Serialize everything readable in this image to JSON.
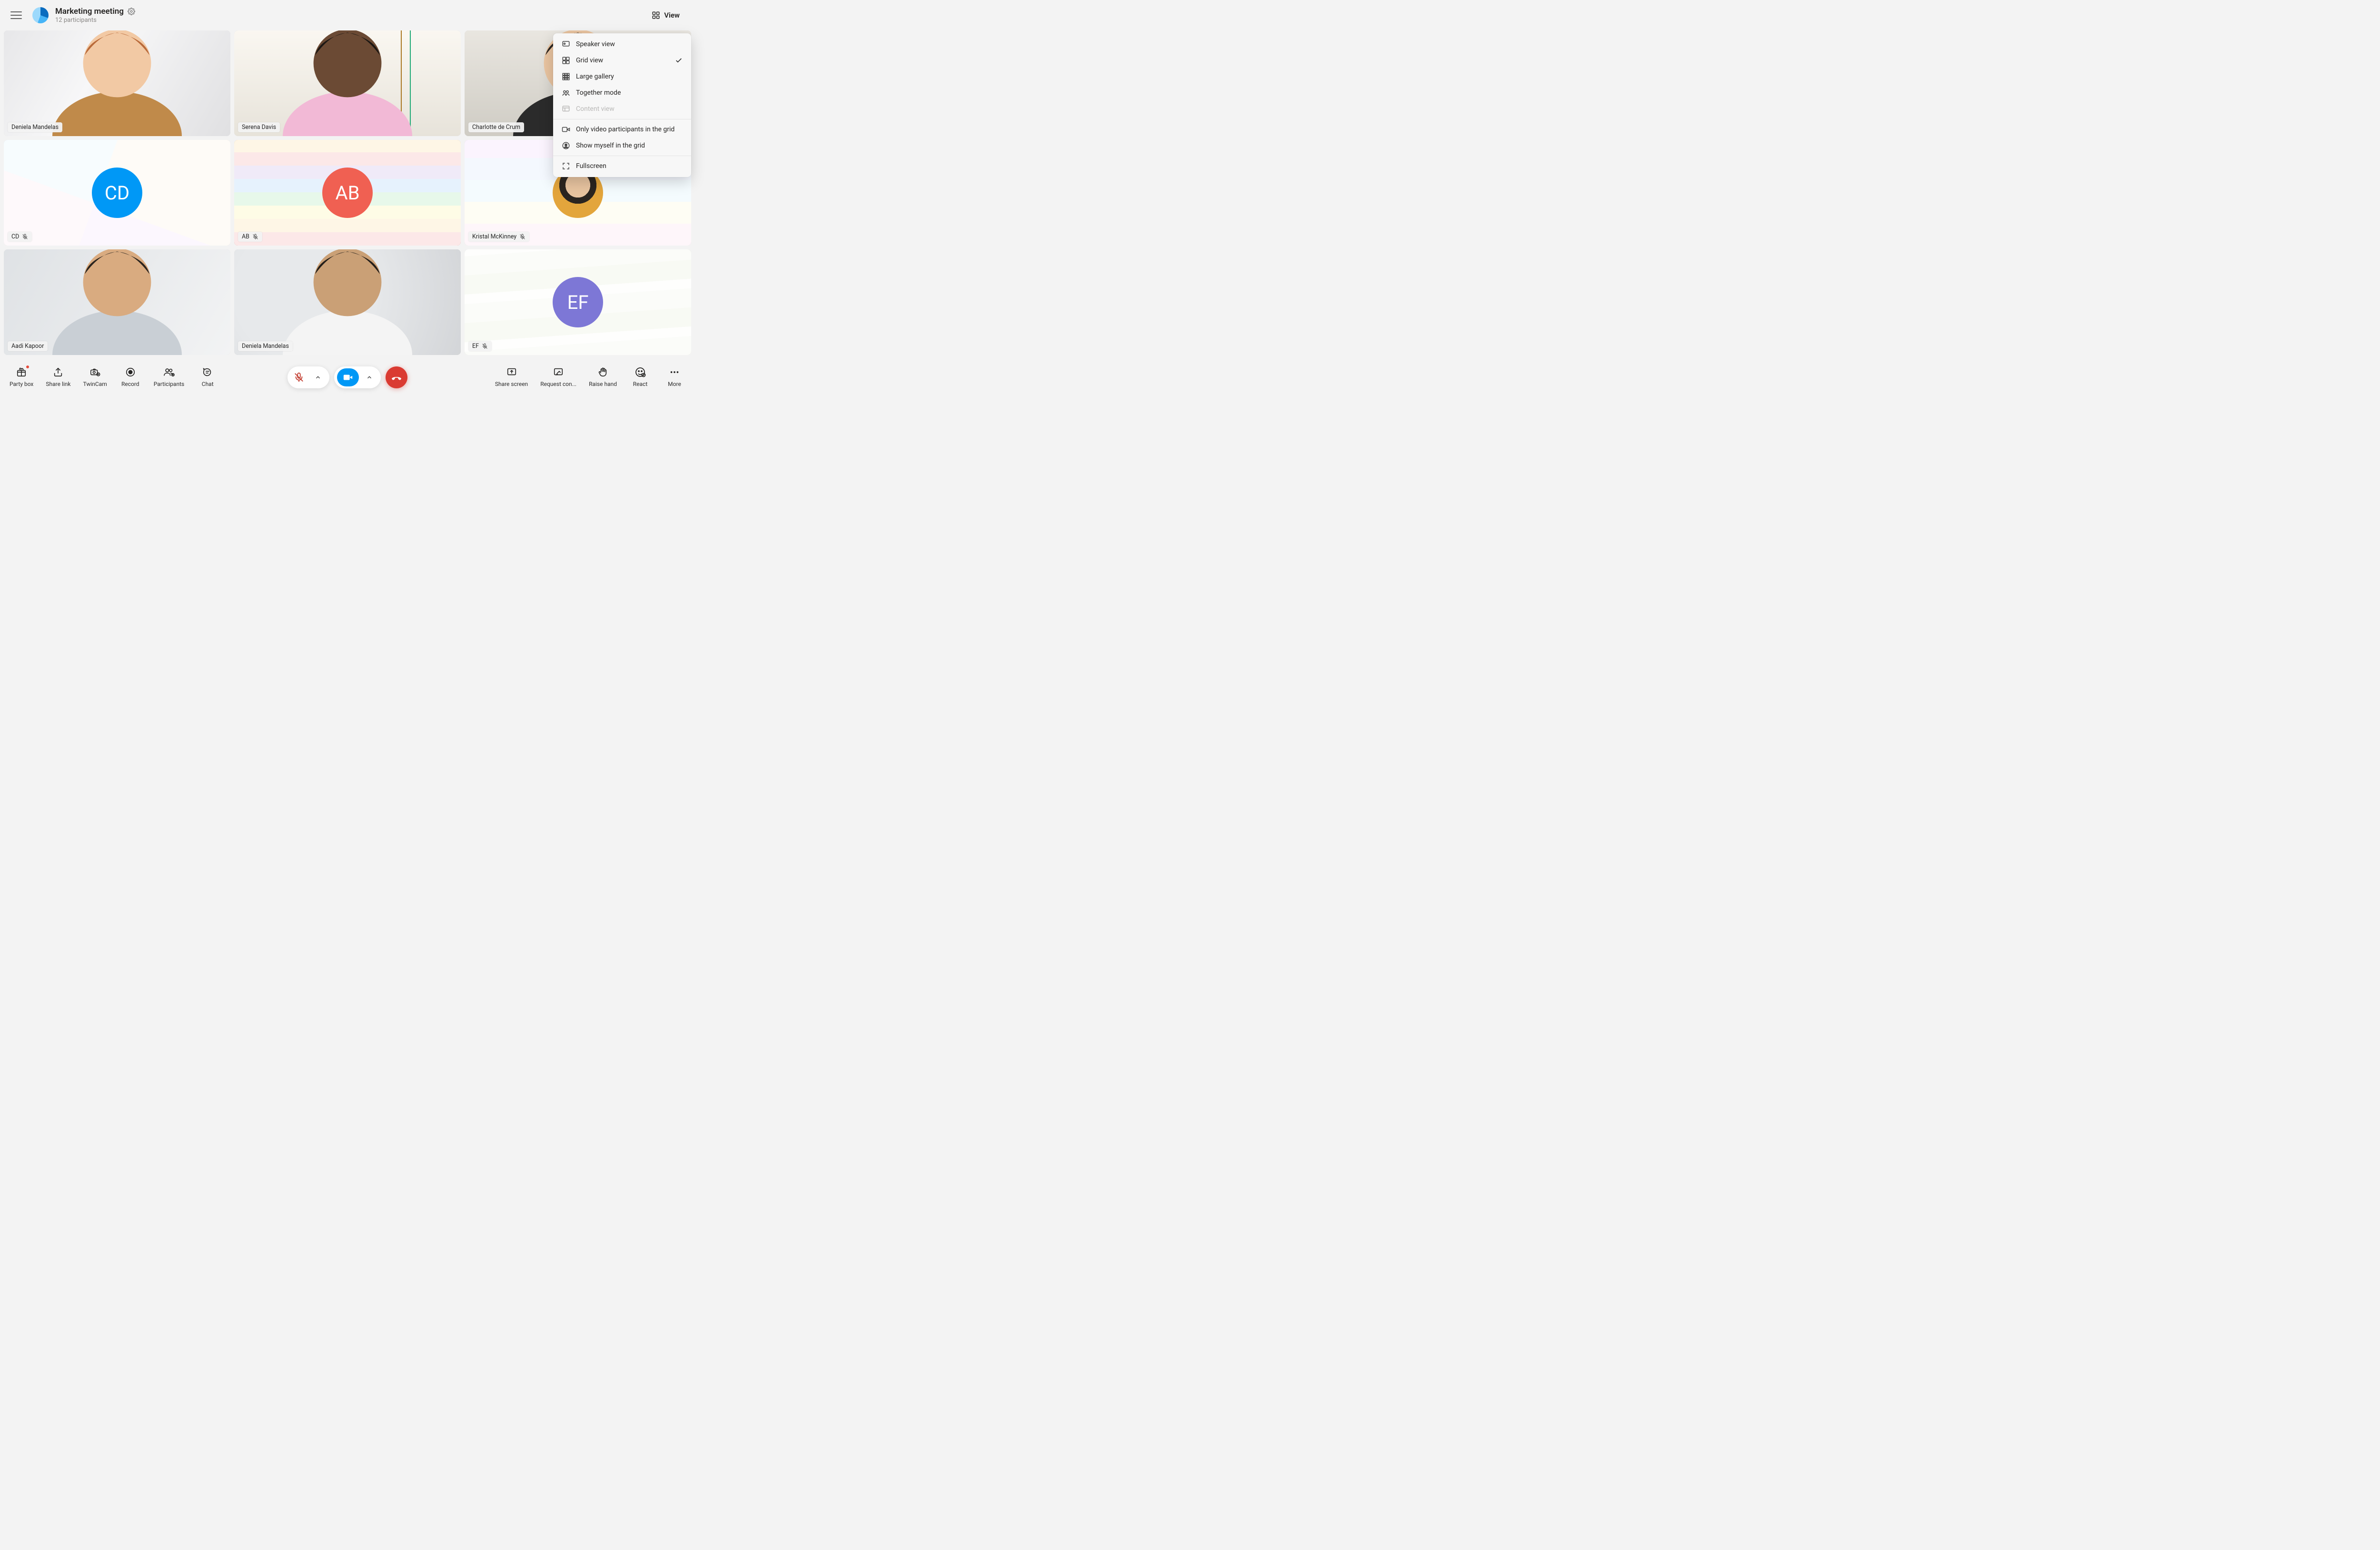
{
  "header": {
    "title": "Marketing meeting",
    "subtitle": "12 participants",
    "viewButton": "View"
  },
  "viewMenu": {
    "items": [
      {
        "icon": "speaker",
        "label": "Speaker view",
        "selected": false
      },
      {
        "icon": "grid",
        "label": "Grid view",
        "selected": true
      },
      {
        "icon": "large",
        "label": "Large gallery",
        "selected": false
      },
      {
        "icon": "together",
        "label": "Together mode",
        "selected": false
      },
      {
        "icon": "content",
        "label": "Content view",
        "disabled": true
      }
    ],
    "options": [
      {
        "icon": "video-only",
        "label": "Only video participants in the grid"
      },
      {
        "icon": "self",
        "label": "Show myself in the grid"
      }
    ],
    "fullscreen": {
      "icon": "fullscreen",
      "label": "Fullscreen"
    }
  },
  "participants": [
    {
      "name": "Deniela Mandelas",
      "type": "video",
      "bg": "bg-office",
      "muted": false
    },
    {
      "name": "Serena Davis",
      "type": "video",
      "bg": "bg-books",
      "muted": false
    },
    {
      "name": "Charlotte de Crum",
      "type": "video",
      "bg": "bg-furn",
      "muted": false
    },
    {
      "name": "CD",
      "type": "initials",
      "initials": "CD",
      "color": "#0098f6",
      "bg": "bg-p1",
      "muted": true
    },
    {
      "name": "AB",
      "type": "initials",
      "initials": "AB",
      "color": "#f06052",
      "bg": "bg-p2",
      "muted": true
    },
    {
      "name": "Kristal McKinney",
      "type": "avatar",
      "bg": "bg-p3",
      "muted": true
    },
    {
      "name": "Aadi Kapoor",
      "type": "video",
      "bg": "bg-indoor",
      "muted": false
    },
    {
      "name": "Deniela Mandelas",
      "type": "video",
      "bg": "bg-blur",
      "muted": false
    },
    {
      "name": "EF",
      "type": "initials",
      "initials": "EF",
      "color": "#7d77d6",
      "bg": "bg-p4",
      "muted": true
    }
  ],
  "bottombar": {
    "left": [
      {
        "id": "party-box",
        "label": "Party box",
        "notif": true
      },
      {
        "id": "share-link",
        "label": "Share link"
      },
      {
        "id": "twincam",
        "label": "TwinCam"
      },
      {
        "id": "record",
        "label": "Record"
      },
      {
        "id": "participants",
        "label": "Participants"
      },
      {
        "id": "chat",
        "label": "Chat"
      }
    ],
    "right": [
      {
        "id": "share-screen",
        "label": "Share screen"
      },
      {
        "id": "request-control",
        "label": "Request con..."
      },
      {
        "id": "raise-hand",
        "label": "Raise hand"
      },
      {
        "id": "react",
        "label": "React"
      },
      {
        "id": "more",
        "label": "More"
      }
    ],
    "callControls": {
      "micMuted": true,
      "cameraOn": true
    }
  }
}
